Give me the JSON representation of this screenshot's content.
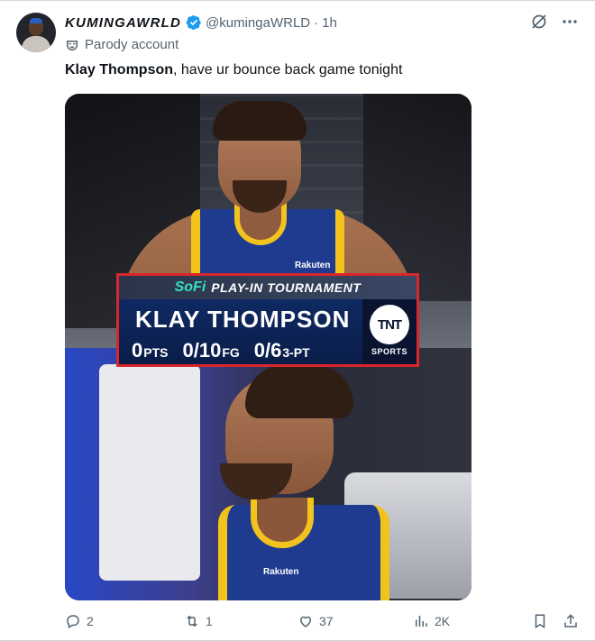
{
  "author": {
    "display_name": "KUMINGAWRLD",
    "handle": "@kumingaWRLD",
    "separator": "·",
    "time": "1h",
    "label": "Parody account"
  },
  "tweet": {
    "bold_text": "Klay Thompson",
    "text": ", have ur bounce back game tonight"
  },
  "media": {
    "overlay": {
      "sponsor": "SoFi",
      "event": "PLAY-IN TOURNAMENT",
      "player_name": "KLAY THOMPSON",
      "stats": [
        {
          "value": "0",
          "unit": "PTS"
        },
        {
          "value": "0/10",
          "unit": "FG"
        },
        {
          "value": "0/6",
          "unit": "3-PT"
        }
      ],
      "network": "TNT",
      "network_sub": "SPORTS"
    },
    "jersey_sponsor": "Rakuten"
  },
  "actions": {
    "replies": "2",
    "reposts": "1",
    "likes": "37",
    "views": "2K"
  },
  "colors": {
    "verified_blue": "#1d9bf0",
    "muted_text": "#536471",
    "overlay_border": "#d9262b",
    "warriors_blue": "#1e3b8f",
    "warriors_gold": "#f2c21d"
  }
}
